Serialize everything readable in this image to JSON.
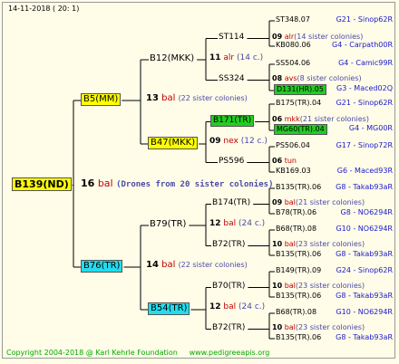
{
  "header": "14-11-2018 ( 20: 1)",
  "root": {
    "label": "B139(ND)",
    "bg": "#ffff00",
    "count": "16",
    "unit": "bal",
    "note": "(Drones from 20 sister colonies)"
  },
  "gen1": [
    {
      "label": "B5(MM)",
      "bg": "#ffff00",
      "count": "13",
      "unit": "bal",
      "note": "(22 sister colonies)"
    },
    {
      "label": "B76(TR)",
      "bg": "#22ddee",
      "count": "14",
      "unit": "bal",
      "note": "(22 sister colonies)"
    }
  ],
  "gen2": [
    {
      "label": "B12(MKK)",
      "bg": "",
      "count": "11",
      "unit": "alr",
      "note": "(14 c.)"
    },
    {
      "label": "B47(MKK)",
      "bg": "#ffff00",
      "count": "09",
      "unit": "nex",
      "note": "(12 c.)"
    },
    {
      "label": "B79(TR)",
      "bg": "",
      "count": "12",
      "unit": "bal",
      "note": "(24 c.)"
    },
    {
      "label": "B54(TR)",
      "bg": "#22ddee",
      "count": "12",
      "unit": "bal",
      "note": "(24 c.)"
    }
  ],
  "gen3": [
    {
      "label": "ST114",
      "bg": "",
      "count": "09",
      "unit": "alr",
      "note": "(14 sister colonies)"
    },
    {
      "label": "SS324",
      "bg": "",
      "count": "08",
      "unit": "avs",
      "note": "(8 sister colonies)"
    },
    {
      "label": "B171(TR)",
      "bg": "#22cc22",
      "count": "06",
      "unit": "mkk",
      "note": "(21 sister colonies)"
    },
    {
      "label": "PS596",
      "bg": "",
      "count": "06",
      "unit": "tun",
      "note": ""
    },
    {
      "label": "B174(TR)",
      "bg": "",
      "count": "09",
      "unit": "bal",
      "note": "(21 sister colonies)"
    },
    {
      "label": "B72(TR)",
      "bg": "",
      "count": "10",
      "unit": "bal",
      "note": "(23 sister colonies)"
    },
    {
      "label": "B70(TR)",
      "bg": "",
      "count": "10",
      "unit": "bal",
      "note": "(23 sister colonies)"
    },
    {
      "label": "B72(TR)",
      "bg": "",
      "count": "10",
      "unit": "bal",
      "note": "(23 sister colonies)"
    }
  ],
  "gen4": [
    {
      "label": "ST348.07",
      "bg": "",
      "colony": "G21 - Sinop62R"
    },
    {
      "label": "KB080.06",
      "bg": "",
      "colony": "G4 - Carpath00R"
    },
    {
      "label": "SS504.06",
      "bg": "",
      "colony": "G4 - Camic99R"
    },
    {
      "label": "D131(HR).05",
      "bg": "#22cc22",
      "colony": "G3 - Maced02Q"
    },
    {
      "label": "B175(TR).04",
      "bg": "",
      "colony": "G21 - Sinop62R"
    },
    {
      "label": "MG60(TR).04",
      "bg": "#22cc22",
      "colony": "G4 - MG00R"
    },
    {
      "label": "PS506.04",
      "bg": "",
      "colony": "G17 - Sinop72R"
    },
    {
      "label": "KB169.03",
      "bg": "",
      "colony": "G6 - Maced93R"
    },
    {
      "label": "B135(TR).06",
      "bg": "",
      "colony": "G8 - Takab93aR"
    },
    {
      "label": "B78(TR).06",
      "bg": "",
      "colony": "G8 - NO6294R"
    },
    {
      "label": "B68(TR).08",
      "bg": "",
      "colony": "G10 - NO6294R"
    },
    {
      "label": "B135(TR).06",
      "bg": "",
      "colony": "G8 - Takab93aR"
    },
    {
      "label": "B149(TR).09",
      "bg": "",
      "colony": "G24 - Sinop62R"
    },
    {
      "label": "B135(TR).06",
      "bg": "",
      "colony": "G8 - Takab93aR"
    },
    {
      "label": "B68(TR).08",
      "bg": "",
      "colony": "G10 - NO6294R"
    },
    {
      "label": "B135(TR).06",
      "bg": "",
      "colony": "G8 - Takab93aR"
    }
  ],
  "footer": {
    "copyright": "Copyright 2004-2018 @ Karl Kehrle Foundation",
    "site": "www.pedigreeapis.org",
    "color": "#00aa00"
  }
}
